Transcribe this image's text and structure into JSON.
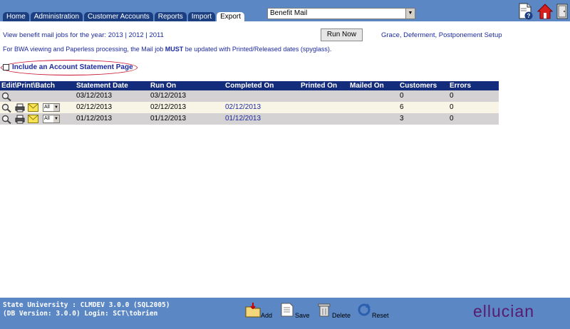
{
  "tabs": [
    "Home",
    "Administration",
    "Customer Accounts",
    "Reports",
    "Import",
    "Export"
  ],
  "active_tab": "Export",
  "job_select": {
    "value": "Benefit Mail"
  },
  "year_line": {
    "prefix": "View benefit mail jobs for the year:",
    "years": [
      "2013",
      "2012",
      "2011"
    ]
  },
  "run_now_label": "Run Now",
  "grace_link": "Grace, Deferment, Postponement Setup",
  "notice": {
    "before": "For BWA viewing and Paperless processing, the Mail job ",
    "strong": "MUST",
    "after": " be updated with Printed/Released dates (spyglass)."
  },
  "include_label": "Include an Account Statement Page",
  "table": {
    "headers": [
      "Edit\\Print\\Batch",
      "Statement Date",
      "Run On",
      "Completed On",
      "Printed On",
      "Mailed On",
      "Customers",
      "Errors"
    ],
    "rows": [
      {
        "statement_date": "03/12/2013",
        "run_on": "03/12/2013",
        "completed_on": "",
        "printed_on": "",
        "mailed_on": "",
        "customers": "0",
        "errors": "0",
        "batch": ""
      },
      {
        "statement_date": "02/12/2013",
        "run_on": "02/12/2013",
        "completed_on": "02/12/2013",
        "printed_on": "",
        "mailed_on": "",
        "customers": "6",
        "errors": "0",
        "batch": "All"
      },
      {
        "statement_date": "01/12/2013",
        "run_on": "01/12/2013",
        "completed_on": "01/12/2013",
        "printed_on": "",
        "mailed_on": "",
        "customers": "3",
        "errors": "0",
        "batch": "All"
      }
    ]
  },
  "footer": {
    "line1": "State University : CLMDEV 3.0.0 (SQL2005)",
    "line2": "(DB Version: 3.0.0) Login: SCT\\tobrien",
    "actions": [
      "Add",
      "Save",
      "Delete",
      "Reset"
    ],
    "logo": "ellucian"
  },
  "icons": [
    "help-doc-icon",
    "home-icon",
    "logout-icon",
    "magnifier-icon",
    "printer-icon",
    "envelope-icon",
    "add-folder-icon",
    "save-icon",
    "trash-icon",
    "reset-icon"
  ],
  "colors": {
    "bar": "#5b87c4",
    "header": "#142c7c",
    "tab": "#1c3f82",
    "link": "#1d2a9e",
    "oval": "#c8102e",
    "logo": "#5a1a6e"
  }
}
